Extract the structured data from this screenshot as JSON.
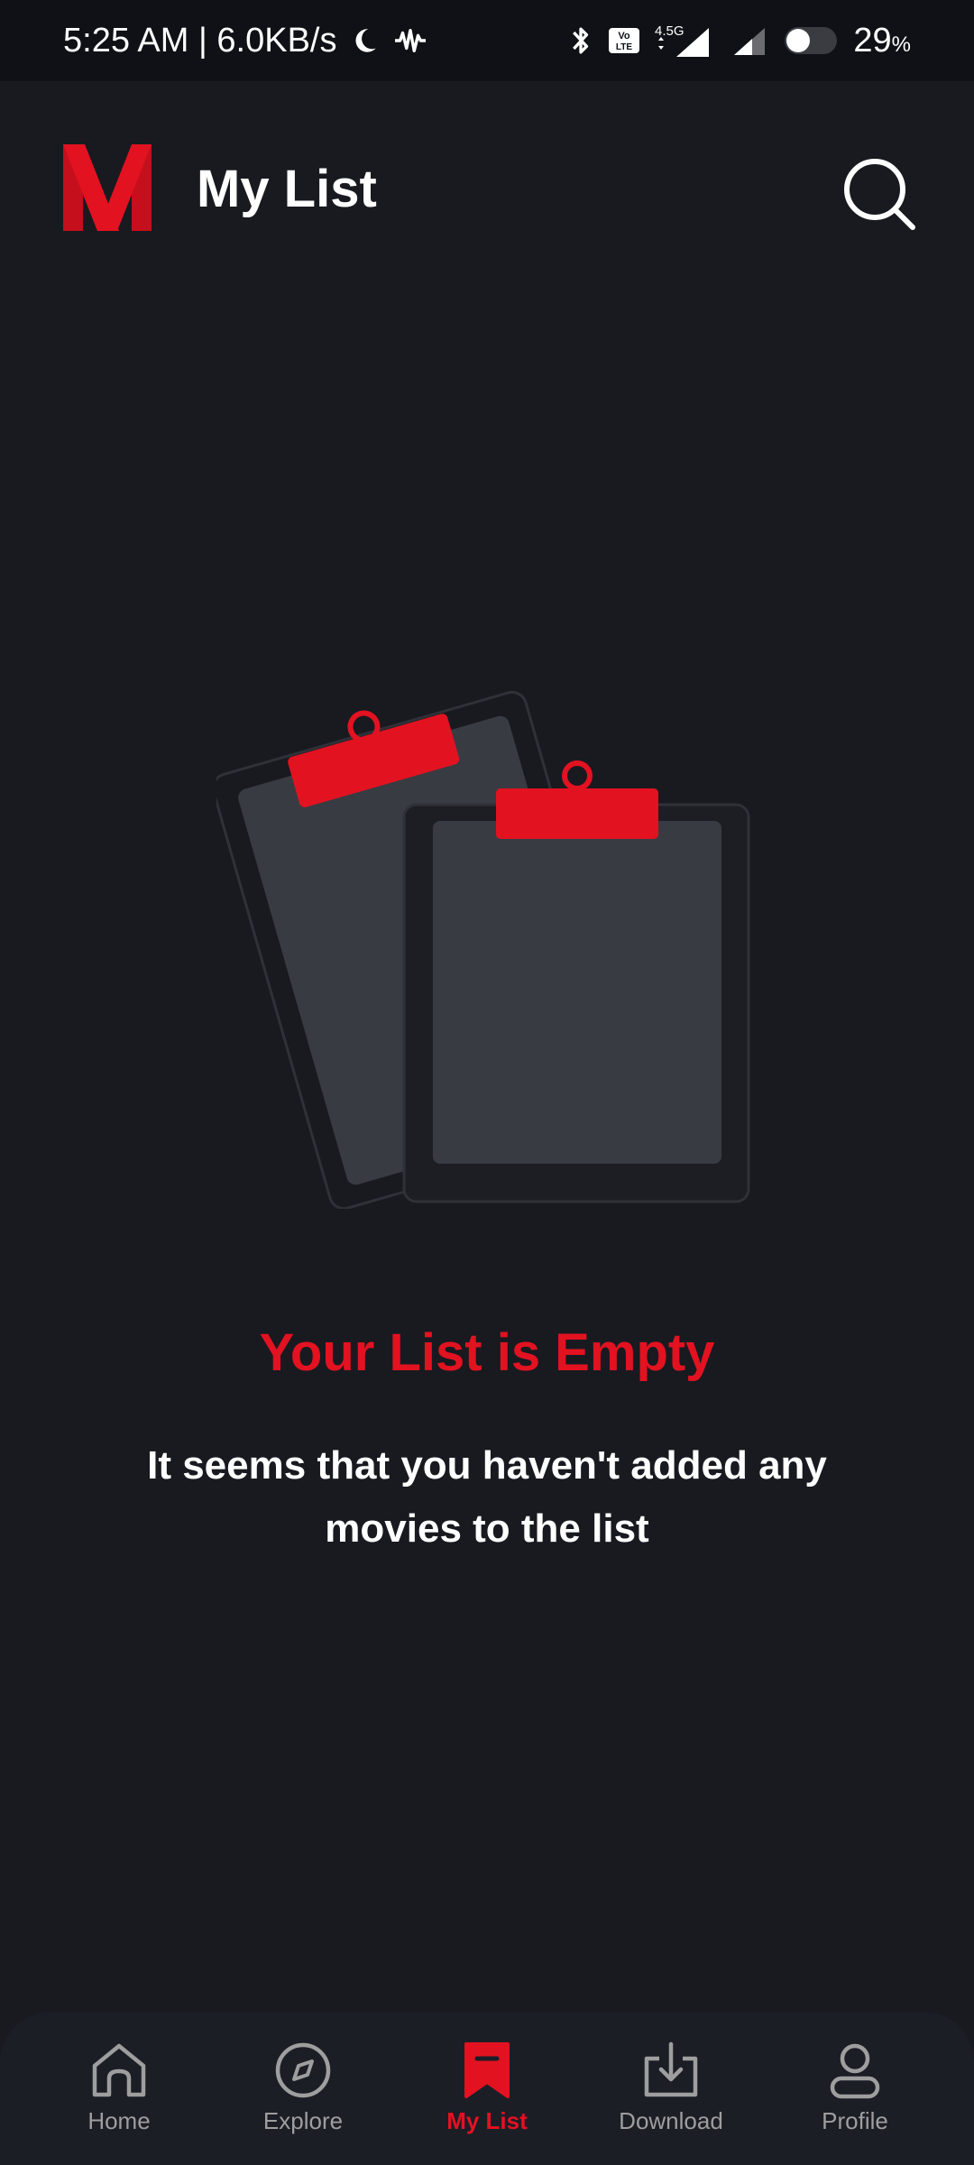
{
  "status_bar": {
    "time_speed": "5:25 AM | 6.0KB/s",
    "network_label": "4.5G",
    "volte_label": "Vo LTE",
    "battery": "29",
    "battery_unit": "%"
  },
  "header": {
    "title": "My List"
  },
  "empty_state": {
    "title": "Your List is Empty",
    "description": "It seems that you haven't added any movies to the list"
  },
  "nav": [
    {
      "label": "Home",
      "icon": "home-icon"
    },
    {
      "label": "Explore",
      "icon": "compass-icon"
    },
    {
      "label": "My List",
      "icon": "bookmark-icon",
      "active": true
    },
    {
      "label": "Download",
      "icon": "download-icon"
    },
    {
      "label": "Profile",
      "icon": "profile-icon"
    }
  ],
  "colors": {
    "background": "#181a20",
    "accent": "#e21221",
    "nav_inactive": "#9e9e9e"
  }
}
